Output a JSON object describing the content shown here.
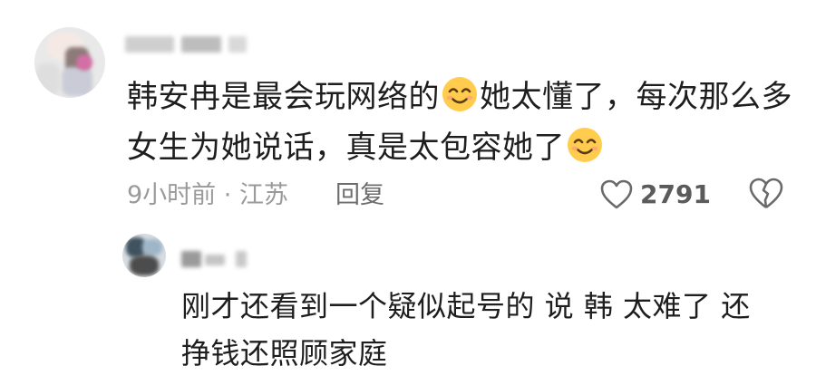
{
  "main_comment": {
    "line1_a": "韩安冉是最会玩网络的",
    "line1_b": "她太懂了，每次那么多",
    "line2": "女生为她说话，真是太包容她了",
    "emoji_icon": "smiling-face-emoji",
    "time": "9小时前",
    "separator": "·",
    "location": "江苏",
    "reply_label": "回复",
    "like_count": "2791",
    "like_icon": "heart-outline-icon",
    "dislike_icon": "broken-heart-icon"
  },
  "reply_comment": {
    "line1": "刚才还看到一个疑似起号的 说 韩 太难了 还",
    "line2": "挣钱还照顾家庭"
  },
  "colors": {
    "text": "#1e1e1e",
    "meta": "#9a9a9a",
    "reply_button": "#6c6c6c",
    "like_count": "#5b5b5b",
    "emoji_face": "#ffcc4d",
    "emoji_cheek": "#ff9f80"
  }
}
